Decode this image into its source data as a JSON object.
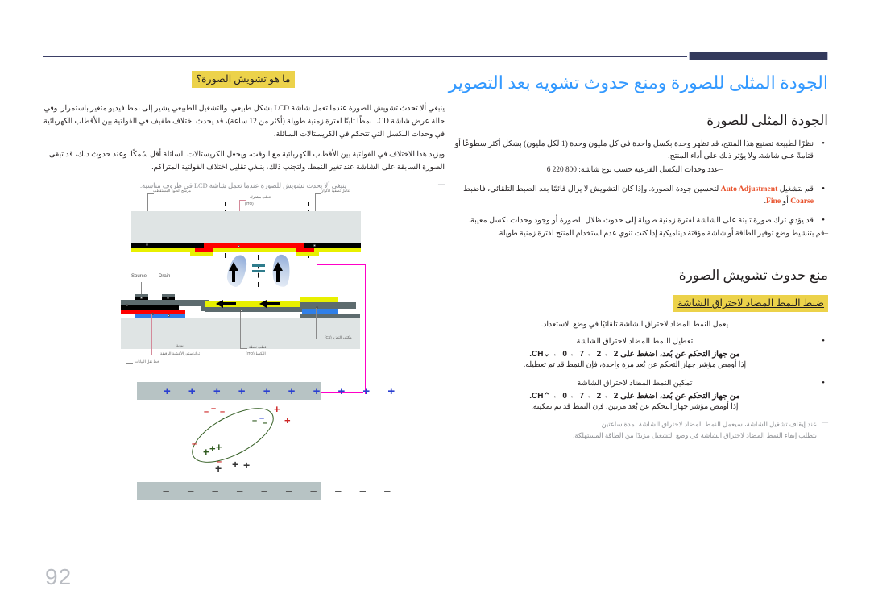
{
  "page": {
    "number": "92",
    "title": "الجودة المثلى للصورة ومنع حدوث تشويه بعد التصوير"
  },
  "right_column": {
    "section1_heading": "الجودة المثلى للصورة",
    "bullets": [
      "نظرًا لطبيعة تصنيع هذا المنتج، قد تظهر وحدة بكسل واحدة في كل مليون وحدة (1 لكل مليون) بشكل أكثر سطوعًا أو قتامةً على شاشة. ولا يؤثر ذلك على أداء المنتج.",
      "قم بتشغيل Auto Adjustment لتحسين جودة الصورة. وإذا كان التشويش لا يزال قائمًا بعد الضبط التلقائي، فاضبط Coarse أو Fine.",
      "قد يؤدي ترك صورة ثابتة على الشاشة لفترة زمنية طويلة إلى حدوث ظلال للصورة أو وجود وحدات بكسل معيبة."
    ],
    "bullet1_sub": "–عدد وحدات البكسل الفرعية حسب نوع شاشة: 800 220 6",
    "bullet2_accent_a": "Auto Adjustment",
    "bullet2_accent_b": "Coarse",
    "bullet2_accent_c": "Fine",
    "bullet3_sub": "–قم بتنشيط وضع توفير الطاقة أو شاشة مؤقتة ديناميكية إذا كنت تنوي عدم استخدام المنتج لفترة زمنية طويلة.",
    "section2_heading": "منع حدوث تشويش الصورة",
    "subsection_heading": "ضبط النمط المضاد لاحتراق الشاشة",
    "intro": "يعمل النمط المضاد لاحتراق الشاشة تلقائيًا في وضع الاستعداد.",
    "items": [
      {
        "label": "تعطيل النمط المضاد لاحتراق الشاشة",
        "command": "من جهاز التحكم عن بُعد، اضغط على 2 ← 2 ← 7 ← CH⌄ ← 0.",
        "result": "إذا أومض مؤشر جهاز التحكم عن بُعد مرة واحدة، فإن النمط قد تم تعطيله."
      },
      {
        "label": "تمكين النمط المضاد لاحتراق الشاشة",
        "command": "من جهاز التحكم عن بُعد، اضغط على 2 ← 2 ← 7 ← CH⌃ ← 0.",
        "result": "إذا أومض مؤشر جهاز التحكم عن بُعد مرتين، فإن النمط قد تم تمكينه."
      }
    ],
    "notes": [
      "عند إيقاف تشغيل الشاشة، سيعمل النمط المضاد لاحتراق الشاشة لمدة ساعتين.",
      "يتطلب إبقاء النمط المضاد لاحتراق الشاشة في وضع التشغيل مزيدًا من الطاقة المستهلكة."
    ]
  },
  "left_column": {
    "heading": "ما هو تشويش الصورة؟",
    "paragraphs": [
      "ينبغي ألا تحدث تشويش للصورة عندما تعمل شاشة LCD بشكل طبيعي. والتشغيل الطبيعي يشير إلى نمط فيديو متغير باستمرار. وفي حالة عرض شاشة LCD نمطًا ثابتًا لفترة زمنية طويلة (أكثر من 12 ساعة)، قد يحدث اختلاف طفيف في الفولتية بين الأقطاب الكهربائية في وحدات البكسل التي تتحكم في الكريستالات السائلة.",
      "ويزيد هذا الاختلاف في الفولتية بين الأقطاب الكهربائية مع الوقت، ويجعل الكريستالات السائلة أقل سُمكًا. وعند حدوث ذلك، قد تبقى الصورة السابقة على الشاشة عند تغير النمط. ولتجنب ذلك، ينبغي تقليل اختلاف الفولتية المتراكم."
    ],
    "note": "ينبغي ألا يحدث تشويش للصورة عندما تعمل شاشة LCD في ظروف مناسبة."
  },
  "diagram": {
    "labels": {
      "polarizer": "مرشح الضوء المستقطب",
      "common_electrode": "قطب مشترك",
      "common_electrode_sub": "(ITO)",
      "color_filter": "عامل تصفية الألوان",
      "source": "Source",
      "drain": "Drain",
      "storage_cap": "مكثف التعزيز(Cs)",
      "pixel_electrode": "قطب نقطة",
      "pixel_electrode_sub": "البكسل(ITO)",
      "gate": "بوابة",
      "tft": "ترانزستور الأغشية الرقيقة",
      "data_line": "خط نقل البيانات"
    },
    "charges": {
      "top_row": "+ + + + + + + + + +",
      "bottom_row": "– – – – – – – – – –"
    },
    "colors": {
      "title_blue": "#3399ff",
      "accent_red": "#e8512b",
      "highlight_yellow": "#ecd24a",
      "header_navy": "#333a5c",
      "pink": "#ff00c8",
      "crystal_green": "#2f5a1e"
    }
  }
}
